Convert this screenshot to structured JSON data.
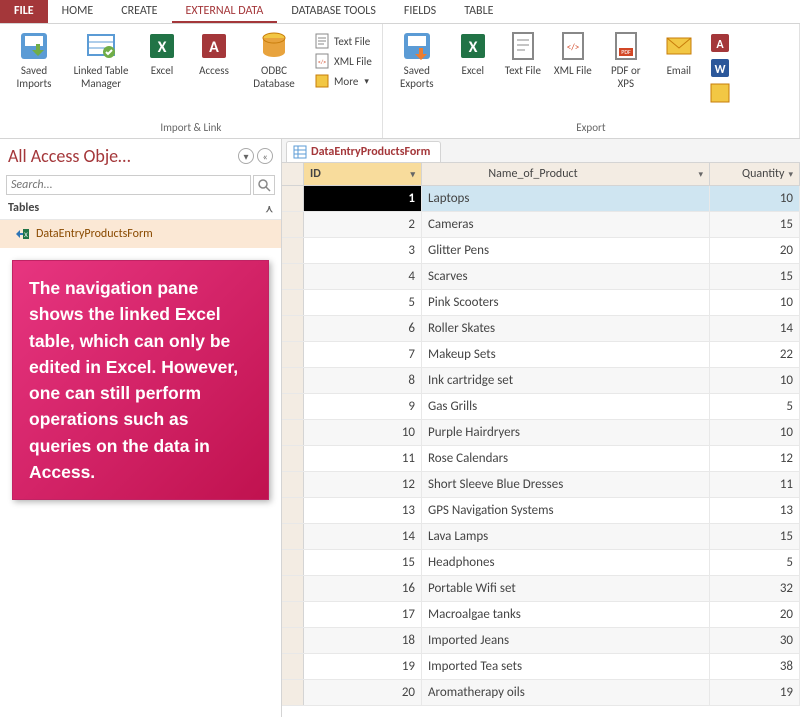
{
  "tabs": {
    "file": "FILE",
    "home": "HOME",
    "create": "CREATE",
    "external": "EXTERNAL DATA",
    "dbtools": "DATABASE TOOLS",
    "fields": "FIELDS",
    "table": "TABLE"
  },
  "ribbon": {
    "import_link": {
      "label": "Import & Link",
      "saved_imports": "Saved Imports",
      "linked_table": "Linked Table Manager",
      "excel": "Excel",
      "access": "Access",
      "odbc": "ODBC Database",
      "text": "Text File",
      "xml": "XML File",
      "more": "More"
    },
    "export": {
      "label": "Export",
      "saved_exports": "Saved Exports",
      "excel": "Excel",
      "text": "Text File",
      "xml": "XML File",
      "pdf": "PDF or XPS",
      "email": "Email"
    }
  },
  "nav": {
    "title": "All Access Obje…",
    "search_placeholder": "Search...",
    "tables": "Tables",
    "linked_item": "DataEntryProductsForm"
  },
  "callout": "The navigation pane shows the linked Excel table, which can only be edited in Excel. However, one can still perform operations such as queries on the data in Access.",
  "doctab": "DataEntryProductsForm",
  "columns": {
    "id": "ID",
    "name": "Name_of_Product",
    "qty": "Quantity"
  },
  "rows": [
    {
      "id": "1",
      "name": "Laptops",
      "qty": "10"
    },
    {
      "id": "2",
      "name": "Cameras",
      "qty": "15"
    },
    {
      "id": "3",
      "name": "Glitter Pens",
      "qty": "20"
    },
    {
      "id": "4",
      "name": "Scarves",
      "qty": "15"
    },
    {
      "id": "5",
      "name": "Pink Scooters",
      "qty": "10"
    },
    {
      "id": "6",
      "name": "Roller Skates",
      "qty": "14"
    },
    {
      "id": "7",
      "name": "Makeup Sets",
      "qty": "22"
    },
    {
      "id": "8",
      "name": "Ink cartridge set",
      "qty": "10"
    },
    {
      "id": "9",
      "name": "Gas Grills",
      "qty": "5"
    },
    {
      "id": "10",
      "name": "Purple Hairdryers",
      "qty": "10"
    },
    {
      "id": "11",
      "name": "Rose Calendars",
      "qty": "12"
    },
    {
      "id": "12",
      "name": "Short Sleeve Blue Dresses",
      "qty": "11"
    },
    {
      "id": "13",
      "name": "GPS Navigation Systems",
      "qty": "13"
    },
    {
      "id": "14",
      "name": "Lava Lamps",
      "qty": "15"
    },
    {
      "id": "15",
      "name": "Headphones",
      "qty": "5"
    },
    {
      "id": "16",
      "name": "Portable Wifi set",
      "qty": "32"
    },
    {
      "id": "17",
      "name": "Macroalgae tanks",
      "qty": "20"
    },
    {
      "id": "18",
      "name": "Imported Jeans",
      "qty": "30"
    },
    {
      "id": "19",
      "name": "Imported Tea sets",
      "qty": "38"
    },
    {
      "id": "20",
      "name": "Aromatherapy oils",
      "qty": "19"
    }
  ]
}
